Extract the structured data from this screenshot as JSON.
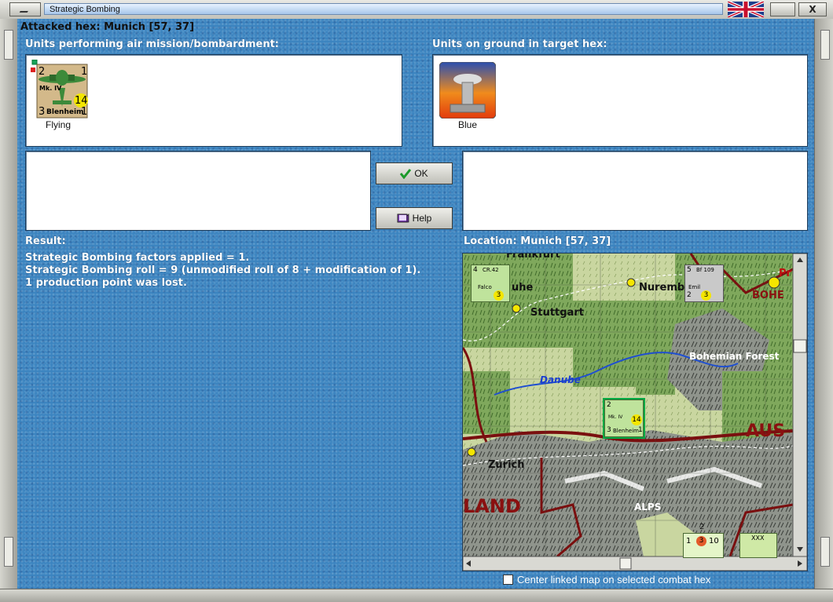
{
  "window": {
    "title": "Strategic Bombing",
    "close_label": "X"
  },
  "header": {
    "attacked_hex": "Attacked hex: Munich  [57, 37]"
  },
  "air": {
    "title": "Units performing air mission/bombardment:",
    "units": [
      {
        "name": "Blenheim",
        "model": "Mk. IV",
        "top_left": "2",
        "top_right": "1",
        "bottom_left": "3",
        "bottom_right": "1",
        "badge": "14",
        "status": "Flying"
      }
    ]
  },
  "ground": {
    "title": "Units on ground in target hex:",
    "units": [
      {
        "status": "Blue"
      }
    ]
  },
  "buttons": {
    "ok": "OK",
    "help": "Help"
  },
  "result": {
    "title": "Result:",
    "lines": [
      "Strategic Bombing factors applied = 1.",
      "Strategic Bombing roll = 9 (unmodified roll of 8 + modification of 1).",
      "1 production point was lost."
    ]
  },
  "location": {
    "title": "Location:  Munich  [57, 37]"
  },
  "map": {
    "labels": {
      "frankfurt": "Frankfurt",
      "karlsruhe": "uhe",
      "stuttgart": "Stuttgart",
      "nuremberg": "Nuremb",
      "bohemian_forest": "Bohemian Forest",
      "danube": "Danube",
      "zurich": "Zurich",
      "land": "LAND",
      "alps": "ALPS",
      "aus": "AUS",
      "bohe": "BOHE",
      "pr": "Pr"
    },
    "counters": {
      "falco": {
        "name": "Falco",
        "model": "CR.42",
        "tl": "4",
        "badge": "3"
      },
      "bf109": {
        "name": "Emil",
        "model": "Bf 109",
        "tl": "5",
        "bl": "2",
        "badge": "3"
      },
      "blenheim": {
        "name": "Blenheim",
        "model": "Mk. IV",
        "tl": "2",
        "bl": "3",
        "br": "1",
        "badge": "14"
      },
      "infantry": {
        "tl": "1",
        "mid": "3",
        "tr": "10",
        "top": "2"
      },
      "xxx": {
        "label": "XXX"
      }
    }
  },
  "option": {
    "center_map": "Center linked map on selected combat hex"
  }
}
